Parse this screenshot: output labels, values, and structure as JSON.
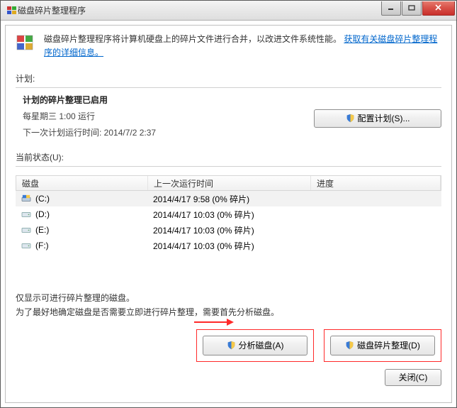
{
  "window": {
    "title": "磁盘碎片整理程序"
  },
  "intro": {
    "text": "磁盘碎片整理程序将计算机硬盘上的碎片文件进行合并，以改进文件系统性能。",
    "link": "获取有关磁盘碎片整理程序的详细信息。"
  },
  "schedule": {
    "label": "计划:",
    "enabled": "计划的碎片整理已启用",
    "line1": "每星期三  1:00 运行",
    "line2": "下一次计划运行时间: 2014/7/2 2:37",
    "configure_btn": "配置计划(S)..."
  },
  "status": {
    "label": "当前状态(U):",
    "headers": {
      "disk": "磁盘",
      "lastrun": "上一次运行时间",
      "progress": "进度"
    },
    "rows": [
      {
        "name": "(C:)",
        "lastrun": "2014/4/17 9:58 (0% 碎片)",
        "selected": true,
        "kind": "os"
      },
      {
        "name": "(D:)",
        "lastrun": "2014/4/17 10:03 (0% 碎片)",
        "selected": false,
        "kind": "hdd"
      },
      {
        "name": "(E:)",
        "lastrun": "2014/4/17 10:03 (0% 碎片)",
        "selected": false,
        "kind": "hdd"
      },
      {
        "name": "(F:)",
        "lastrun": "2014/4/17 10:03 (0% 碎片)",
        "selected": false,
        "kind": "hdd"
      }
    ]
  },
  "note": {
    "line1": "仅显示可进行碎片整理的磁盘。",
    "line2": "为了最好地确定磁盘是否需要立即进行碎片整理，需要首先分析磁盘。"
  },
  "buttons": {
    "analyze": "分析磁盘(A)",
    "defrag": "磁盘碎片整理(D)",
    "close": "关闭(C)"
  }
}
